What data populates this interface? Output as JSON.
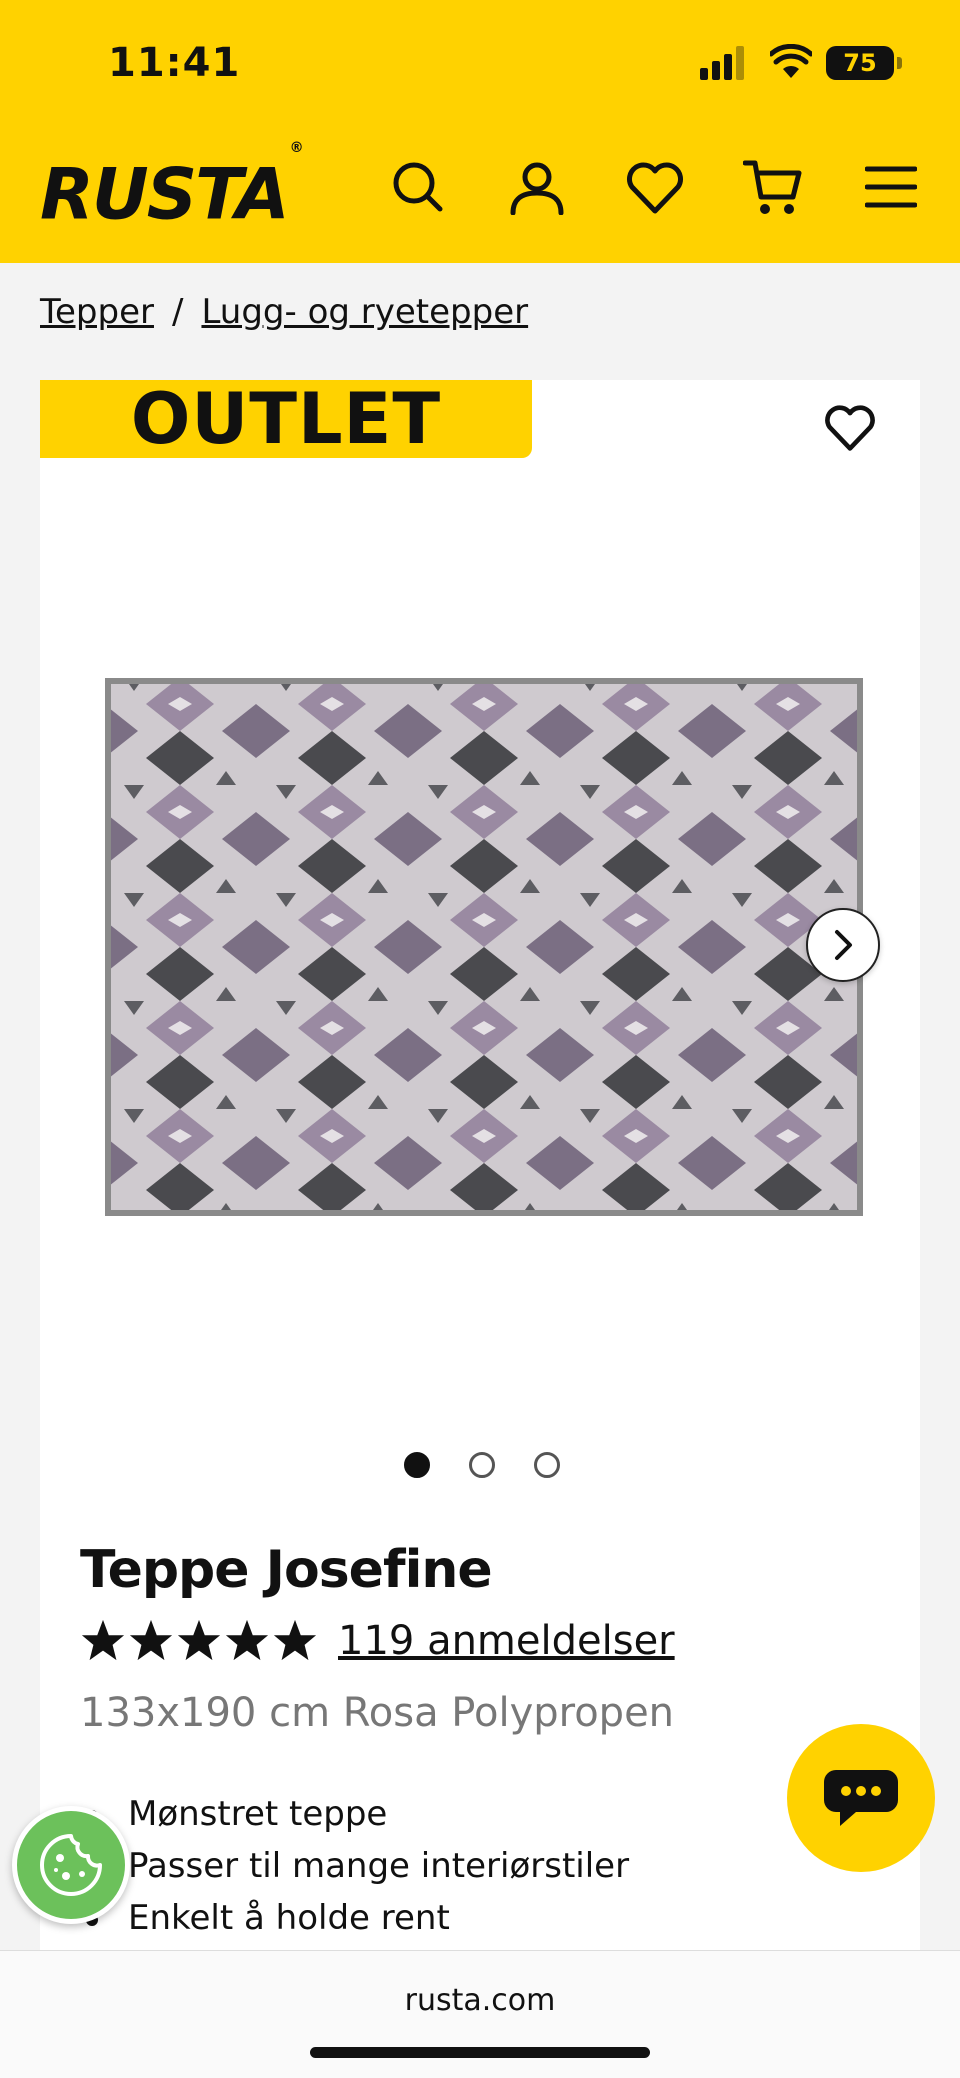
{
  "status": {
    "time": "11:41",
    "battery": "75"
  },
  "header": {
    "logo": "RUSTA",
    "logo_mark": "®"
  },
  "breadcrumb": {
    "items": [
      "Tepper",
      "Lugg- og ryetepper"
    ],
    "separator": "/"
  },
  "badge": {
    "label": "OUTLET"
  },
  "gallery": {
    "total": 3,
    "active": 1
  },
  "product": {
    "name": "Teppe Josefine",
    "rating": 5,
    "reviews": "119 anmeldelser",
    "subtitle": "133x190 cm Rosa Polypropen",
    "features": [
      "Mønstret teppe",
      "Passer til mange interiørstiler",
      "Enkelt å holde rent"
    ]
  },
  "browser": {
    "url": "rusta.com"
  },
  "colors": {
    "brand": "#ffd200",
    "cookie": "#6cc15b"
  }
}
